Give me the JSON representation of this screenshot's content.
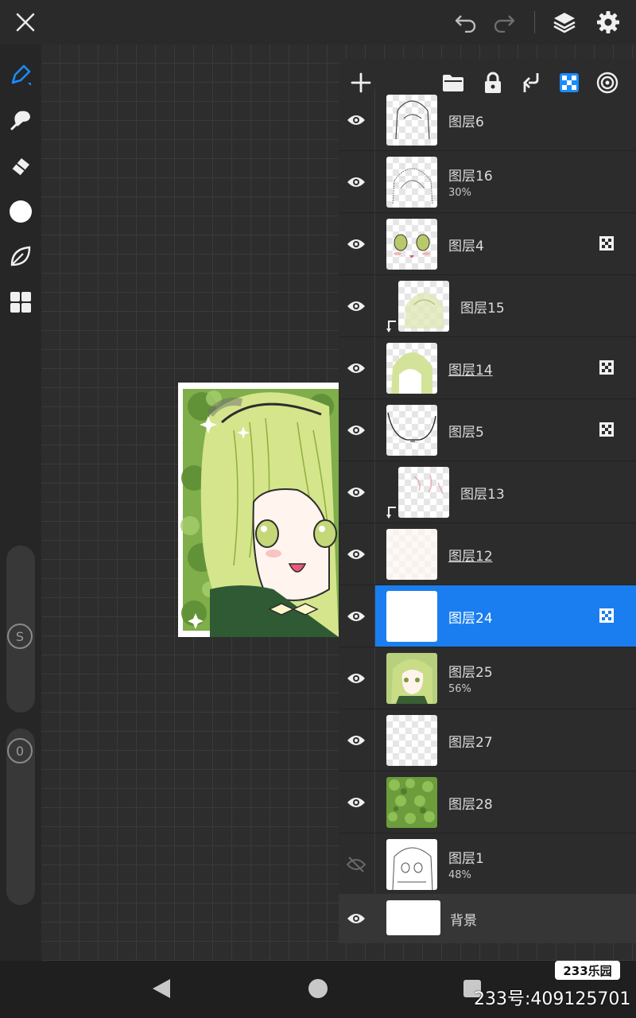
{
  "app": {
    "icons": {
      "close": "close-icon",
      "undo": "undo-icon",
      "redo": "redo-icon",
      "layers": "layers-icon",
      "settings": "gear-icon"
    }
  },
  "left_toolbar": {
    "tools": [
      "pen-icon",
      "smudge-icon",
      "eraser-icon",
      "color-icon",
      "leaf-icon",
      "grid-icon"
    ],
    "size_slider": {
      "label": "S"
    },
    "opacity_slider": {
      "label": "0"
    }
  },
  "layers_panel": {
    "toolbar_icons": [
      "add-icon",
      "folder-icon",
      "lock-icon",
      "merge-down-icon",
      "checker-icon",
      "target-icon"
    ],
    "layers": [
      {
        "name": "图层6",
        "opacity": "",
        "visible": true,
        "clipped": false,
        "alpha_lock": false,
        "underlined": false,
        "selected": false
      },
      {
        "name": "图层16",
        "opacity": "30%",
        "visible": true,
        "clipped": false,
        "alpha_lock": false,
        "underlined": false,
        "selected": false
      },
      {
        "name": "图层4",
        "opacity": "",
        "visible": true,
        "clipped": false,
        "alpha_lock": true,
        "underlined": false,
        "selected": false
      },
      {
        "name": "图层15",
        "opacity": "",
        "visible": true,
        "clipped": true,
        "alpha_lock": false,
        "underlined": false,
        "selected": false
      },
      {
        "name": "图层14",
        "opacity": "",
        "visible": true,
        "clipped": false,
        "alpha_lock": true,
        "underlined": true,
        "selected": false
      },
      {
        "name": "图层5",
        "opacity": "",
        "visible": true,
        "clipped": false,
        "alpha_lock": true,
        "underlined": false,
        "selected": false
      },
      {
        "name": "图层13",
        "opacity": "",
        "visible": true,
        "clipped": true,
        "alpha_lock": false,
        "underlined": false,
        "selected": false
      },
      {
        "name": "图层12",
        "opacity": "",
        "visible": true,
        "clipped": false,
        "alpha_lock": false,
        "underlined": true,
        "selected": false
      },
      {
        "name": "图层24",
        "opacity": "",
        "visible": true,
        "clipped": false,
        "alpha_lock": true,
        "underlined": false,
        "selected": true
      },
      {
        "name": "图层25",
        "opacity": "56%",
        "visible": true,
        "clipped": false,
        "alpha_lock": false,
        "underlined": false,
        "selected": false
      },
      {
        "name": "图层27",
        "opacity": "",
        "visible": true,
        "clipped": false,
        "alpha_lock": false,
        "underlined": false,
        "selected": false
      },
      {
        "name": "图层28",
        "opacity": "",
        "visible": true,
        "clipped": false,
        "alpha_lock": false,
        "underlined": false,
        "selected": false
      },
      {
        "name": "图层1",
        "opacity": "48%",
        "visible": false,
        "clipped": false,
        "alpha_lock": false,
        "underlined": false,
        "selected": false
      }
    ],
    "background": {
      "name": "背景",
      "visible": true
    }
  },
  "watermark": {
    "logo": "233乐园",
    "id_text": "233号:409125701"
  },
  "colors": {
    "accent": "#1a7ef0",
    "panel": "#2c2c2c",
    "canvas_bg": "#2d2d2d"
  }
}
